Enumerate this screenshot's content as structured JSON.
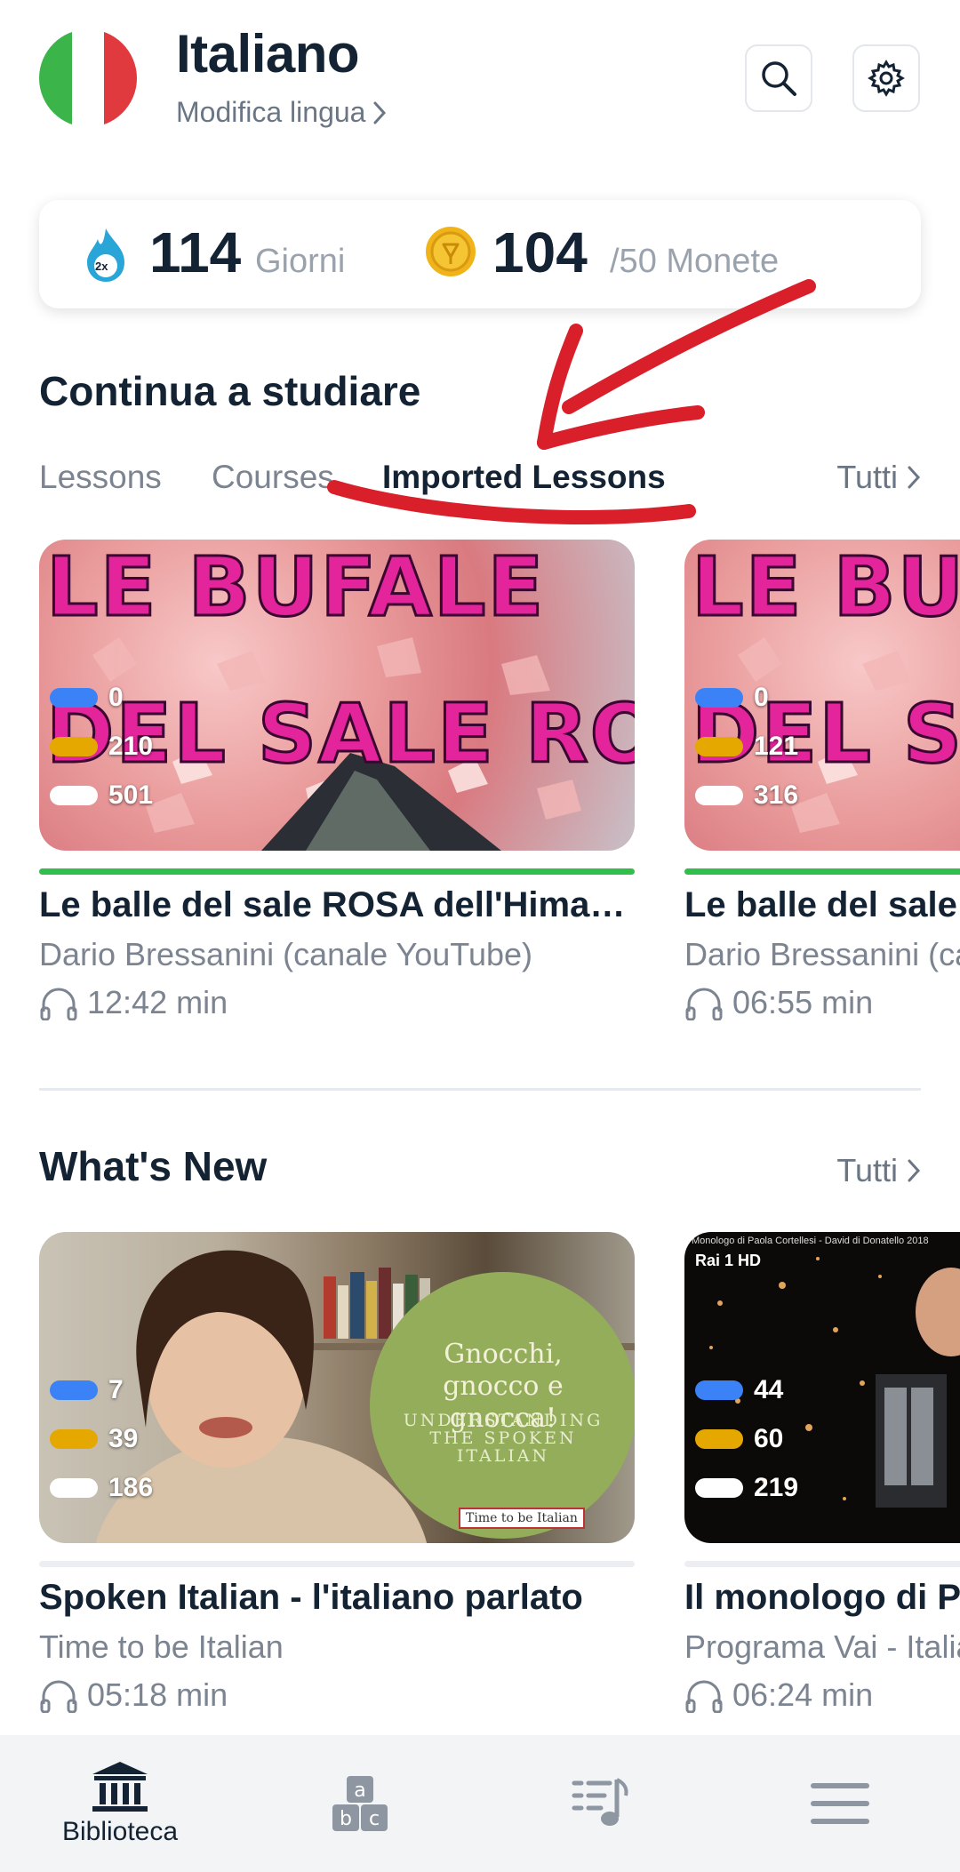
{
  "header": {
    "title": "Italiano",
    "edit_label": "Modifica lingua",
    "flag_colors": [
      "#3bb54a",
      "#ffffff",
      "#e0393e"
    ],
    "search_icon": "search-icon",
    "settings_icon": "gear-icon"
  },
  "stats": {
    "streak_value": "114",
    "streak_label": "Giorni",
    "streak_badge": "2x",
    "coins_value": "104",
    "coins_label": "/50 Monete"
  },
  "continue": {
    "title": "Continua a studiare",
    "all_label": "Tutti",
    "tabs": [
      {
        "label": "Lessons",
        "active": false
      },
      {
        "label": "Courses",
        "active": false
      },
      {
        "label": "Imported Lessons",
        "active": true
      }
    ],
    "cards": [
      {
        "thumb_line1": "LE BUFALE",
        "thumb_line2": "DEL SALE ROSA",
        "counts": [
          "0",
          "210",
          "501"
        ],
        "title": "Le balle del sale ROSA dell'Himalaya",
        "subtitle": "Dario Bressanini (canale YouTube)",
        "duration": "12:42 min",
        "progress_color": "#2fbf4a"
      },
      {
        "thumb_line1": "LE BUFALE",
        "thumb_line2": "DEL SALE ROSA",
        "counts": [
          "0",
          "121",
          "316"
        ],
        "title": "Le balle del sale ROSA dell'Himalaya",
        "subtitle": "Dario Bressanini (canale YouTube)",
        "duration": "06:55 min",
        "progress_color": "#2fbf4a"
      }
    ]
  },
  "whats_new": {
    "title": "What's New",
    "all_label": "Tutti",
    "cards": [
      {
        "circle_title": "Gnocchi, gnocco e gnocca!",
        "circle_sub": "UNDERSTANDING THE SPOKEN ITALIAN",
        "circle_tag": "Time to be Italian",
        "counts": [
          "7",
          "39",
          "186"
        ],
        "title": "Spoken Italian - l'italiano parlato",
        "subtitle": "Time to be Italian",
        "duration": "05:18 min"
      },
      {
        "video_caption": "Monologo di Paola Cortellesi - David di Donatello 2018",
        "channel_logo": "Rai 1 HD",
        "counts": [
          "44",
          "60",
          "219"
        ],
        "title": "Il monologo di Paola Cortellesi",
        "subtitle": "Programa Vai - Italiano",
        "duration": "06:24 min"
      }
    ]
  },
  "count_colors": [
    "#3b82f6",
    "#e5a800",
    "#ffffff"
  ],
  "nav": {
    "items": [
      {
        "label": "Biblioteca",
        "icon": "library-icon",
        "active": true
      },
      {
        "label": "",
        "icon": "vocabulary-icon",
        "active": false
      },
      {
        "label": "",
        "icon": "playlist-icon",
        "active": false
      },
      {
        "label": "",
        "icon": "menu-icon",
        "active": false
      }
    ]
  }
}
